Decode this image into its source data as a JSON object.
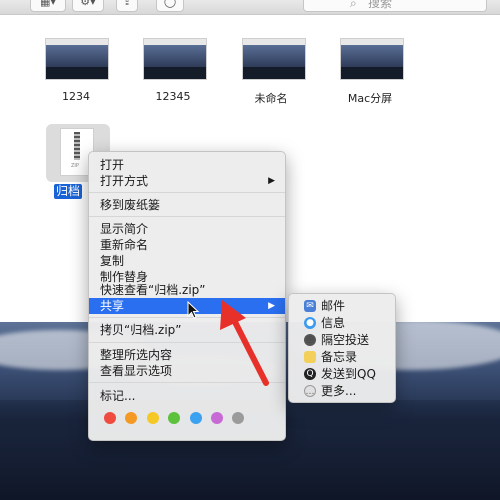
{
  "toolbar": {
    "search_placeholder": "搜索",
    "search_icon": "magnifier-icon",
    "buttons": [
      "view-grid-icon",
      "gear-icon",
      "share-icon",
      "tag-icon"
    ]
  },
  "files": [
    {
      "name": "1234"
    },
    {
      "name": "12345"
    },
    {
      "name": "未命名"
    },
    {
      "name": "Mac分屏"
    }
  ],
  "selected_file": {
    "name": "归档",
    "icon_text": "ZIP"
  },
  "context_menu": {
    "items": [
      {
        "label": "打开",
        "submenu": false
      },
      {
        "label": "打开方式",
        "submenu": true
      },
      {
        "label": "移到废纸篓",
        "submenu": false
      },
      {
        "label": "显示简介",
        "submenu": false
      },
      {
        "label": "重新命名",
        "submenu": false
      },
      {
        "label": "复制",
        "submenu": false
      },
      {
        "label": "制作替身",
        "submenu": false
      },
      {
        "label": "快速查看“归档.zip”",
        "submenu": false
      },
      {
        "label": "共享",
        "submenu": true,
        "highlighted": true
      },
      {
        "label": "拷贝“归档.zip”",
        "submenu": false
      },
      {
        "label": "整理所选内容",
        "submenu": false
      },
      {
        "label": "查看显示选项",
        "submenu": false
      },
      {
        "label": "标记...",
        "submenu": false
      }
    ],
    "submenu_arrow": "▶",
    "tag_colors": [
      "#ef4b3f",
      "#f49a24",
      "#f5c825",
      "#5cc13b",
      "#3aa2f1",
      "#c86ad6",
      "#9b9b9b"
    ]
  },
  "share_submenu": {
    "items": [
      {
        "label": "邮件",
        "icon": "mail-icon",
        "color": "#4a7fd8"
      },
      {
        "label": "信息",
        "icon": "messages-icon",
        "color": "#3c9bf0"
      },
      {
        "label": "隔空投送",
        "icon": "airdrop-icon",
        "color": "#555555"
      },
      {
        "label": "备忘录",
        "icon": "notes-icon",
        "color": "#f3d05a"
      },
      {
        "label": "发送到QQ",
        "icon": "qq-icon",
        "color": "#222222"
      },
      {
        "label": "更多...",
        "icon": "more-icon",
        "color": "#888888"
      }
    ]
  },
  "annotation": {
    "arrow_color": "#e8302a"
  }
}
